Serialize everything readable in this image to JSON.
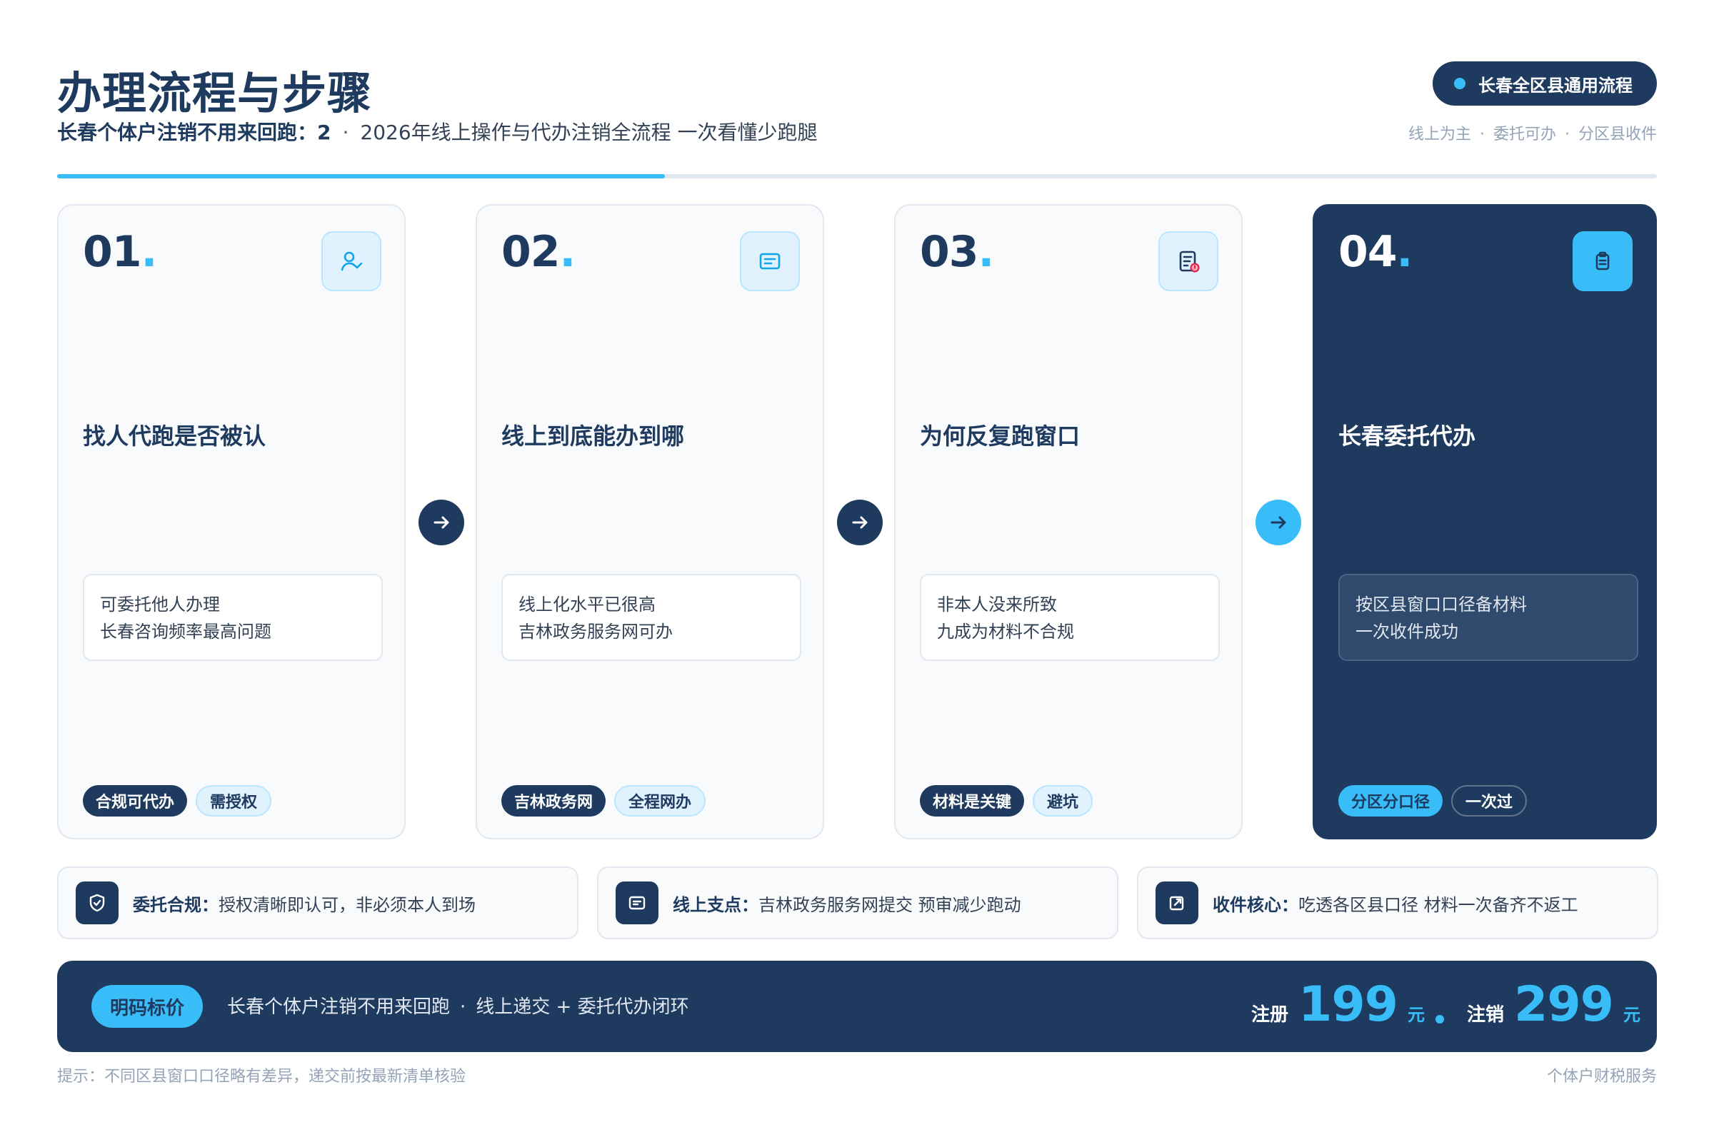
{
  "header": {
    "title": "办理流程与步骤",
    "subtitle_strong": "长春个体户注销不用来回跑：2",
    "subtitle_sep": "·",
    "subtitle_rest": "2026年线上操作与代办注销全流程 一次看懂少跑腿",
    "region_badge": "长春全区县通用流程",
    "tagline": [
      "线上为主",
      "委托可办",
      "分区县收件"
    ],
    "tagline_sep": "·",
    "progress": 0.38
  },
  "steps": [
    {
      "num": "01",
      "dot": ".",
      "icon": "user-check-icon",
      "title": "找人代跑是否被认",
      "desc_line1": "可委托他人办理",
      "desc_line2": "长春咨询频率最高问题",
      "tag1": "合规可代办",
      "tag2": "需授权"
    },
    {
      "num": "02",
      "dot": ".",
      "icon": "online-form-icon",
      "title": "线上到底能办到哪",
      "desc_line1": "线上化水平已很高",
      "desc_line2": "吉林政务服务网可办",
      "tag1": "吉林政务网",
      "tag2": "全程网办"
    },
    {
      "num": "03",
      "dot": ".",
      "icon": "document-warning-icon",
      "title": "为何反复跑窗口",
      "desc_line1": "非本人没来所致",
      "desc_line2": "九成为材料不合规",
      "tag1": "材料是关键",
      "tag2": "避坑"
    },
    {
      "num": "04",
      "dot": ".",
      "icon": "clipboard-icon",
      "title": "长春委托代办",
      "desc_line1": "按区县窗口口径备材料",
      "desc_line2": "一次收件成功",
      "tag1": "分区分口径",
      "tag2": "一次过"
    }
  ],
  "info_cards": [
    {
      "icon": "shield-check-icon",
      "label": "委托合规：",
      "text": "授权清晰即认可，非必须本人到场"
    },
    {
      "icon": "message-box-icon",
      "label": "线上支点：",
      "text": "吉林政务服务网提交 预审减少跑动"
    },
    {
      "icon": "external-link-icon",
      "label": "收件核心：",
      "text": "吃透各区县口径 材料一次备齐不返工"
    }
  ],
  "footer": {
    "pill": "明码标价",
    "text_a": "长春个体户注销不用来回跑",
    "text_sep": "·",
    "text_b": "线上递交 + 委托代办闭环",
    "price1_label": "注册",
    "price1_value": "199",
    "price1_unit": "元",
    "price2_label": "注销",
    "price2_value": "299",
    "price2_unit": "元"
  },
  "notes": {
    "left": "提示：不同区县窗口口径略有差异，递交前按最新清单核验",
    "right": "个体户财税服务"
  },
  "colors": {
    "navy": "#1e3a5f",
    "accent": "#38bdf8",
    "muted": "#94a3b8"
  }
}
